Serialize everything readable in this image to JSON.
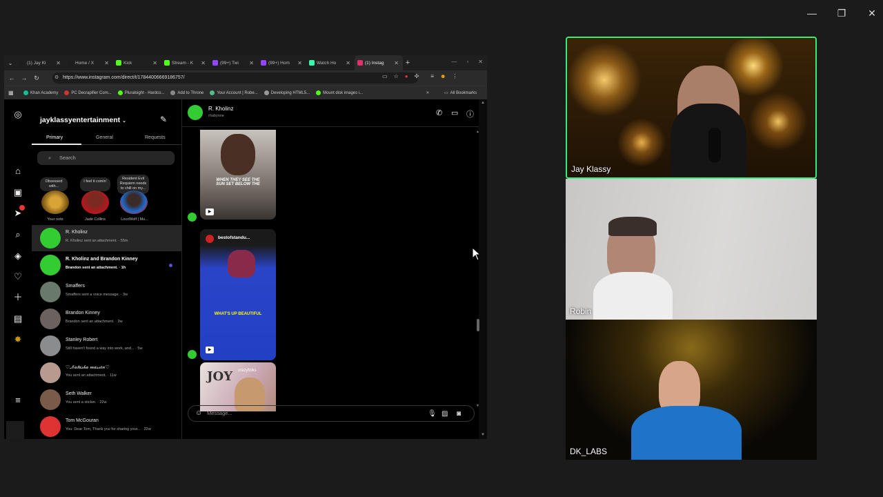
{
  "window_controls": {
    "minimize": "—",
    "restore": "❐",
    "close": "✕"
  },
  "browser": {
    "tabs": [
      {
        "label": "(1) Jay Kl",
        "color": "#1d1d1d",
        "mark": "𝕏"
      },
      {
        "label": "Home / X",
        "color": "#1d1d1d",
        "mark": "𝕏"
      },
      {
        "label": "Kick",
        "color": "#53fc18",
        "mark": "K"
      },
      {
        "label": "Stream - K",
        "color": "#53fc18",
        "mark": "K"
      },
      {
        "label": "(99+) Twi",
        "color": "#9146ff",
        "mark": ""
      },
      {
        "label": "(99+) Hom",
        "color": "#9146ff",
        "mark": ""
      },
      {
        "label": "Watch Ho",
        "color": "#3fa",
        "mark": ""
      },
      {
        "label": "(1) Instag",
        "color": "#e1306c",
        "mark": ""
      }
    ],
    "new_tab": "+",
    "url": "https://www.instagram.com/direct/t/17844006669186757/",
    "bookmarks": [
      {
        "label": "Khan Academy",
        "color": "#14bf96"
      },
      {
        "label": "PC Decrapifier Com...",
        "color": "#c33"
      },
      {
        "label": "Pluralsight - Hardco...",
        "color": "#53fc18"
      },
      {
        "label": "Add to Throne",
        "color": "#888"
      },
      {
        "label": "Your Account | Robe...",
        "color": "#5b8"
      },
      {
        "label": "Developing HTML5...",
        "color": "#999"
      },
      {
        "label": "Mount disk images i...",
        "color": "#53fc18"
      }
    ],
    "all_bookmarks": "All Bookmarks"
  },
  "instagram": {
    "account": "jayklassyentertainment",
    "tabs": {
      "primary": "Primary",
      "general": "General",
      "requests": "Requests"
    },
    "search_placeholder": "Search",
    "notes": [
      {
        "bubble": "Obsessed with...",
        "label": "Your note"
      },
      {
        "bubble": "I feel it comin'",
        "label": "Jade Collins"
      },
      {
        "bubble": "Resident Evil Requiem needs to chill on my...",
        "label": "LocoWolf | Mu..."
      }
    ],
    "conversations": [
      {
        "name": "R. Kholinz",
        "preview": "R. Kholinz sent an attachment. · 55m",
        "unread": false
      },
      {
        "name": "R. Kholinz and Brandon Kinney",
        "preview": "Brandon sent an attachment. · 1h",
        "unread": true
      },
      {
        "name": "Smaffers",
        "preview": "Smaffers sent a voice message. · 3w",
        "unread": false
      },
      {
        "name": "Brandon Kinney",
        "preview": "Brandon sent an attachment. · 3w",
        "unread": false
      },
      {
        "name": "Stanley Robert",
        "preview": "Still haven't found a way into work, and... · 5w",
        "unread": false
      },
      {
        "name": "♡𝒩𝒶𝓉𝒶𝓈𝒽𝒶 𝓂𝒶𝓈𝓈𝑒𝓃♡",
        "preview": "You sent an attachment. · 11w",
        "unread": false
      },
      {
        "name": "Seth Walker",
        "preview": "You sent a sticker. · 22w",
        "unread": false
      },
      {
        "name": "Tom McGouran",
        "preview": "You: Dear Tom, Thank you for sharing your... · 22w",
        "unread": false
      }
    ],
    "chat": {
      "name": "R. Kholinz",
      "username": "rhabynne",
      "media1_caption": "WHEN THEY SEE THE SUN SET BELOW THE",
      "media2_account": "bestofstandu...",
      "media2_caption": "WHAT'S UP BEAUTIFUL",
      "media3_account": "crazyfolks",
      "media3_text": "JOY",
      "message_placeholder": "Message..."
    }
  },
  "participants": [
    {
      "name": "Jay Klassy",
      "active": true
    },
    {
      "name": "Robin",
      "active": false
    },
    {
      "name": "DK_LABS",
      "active": false
    }
  ],
  "colors": {
    "active_speaker": "#2ef07a",
    "unread_dot": "#5b51d8"
  }
}
